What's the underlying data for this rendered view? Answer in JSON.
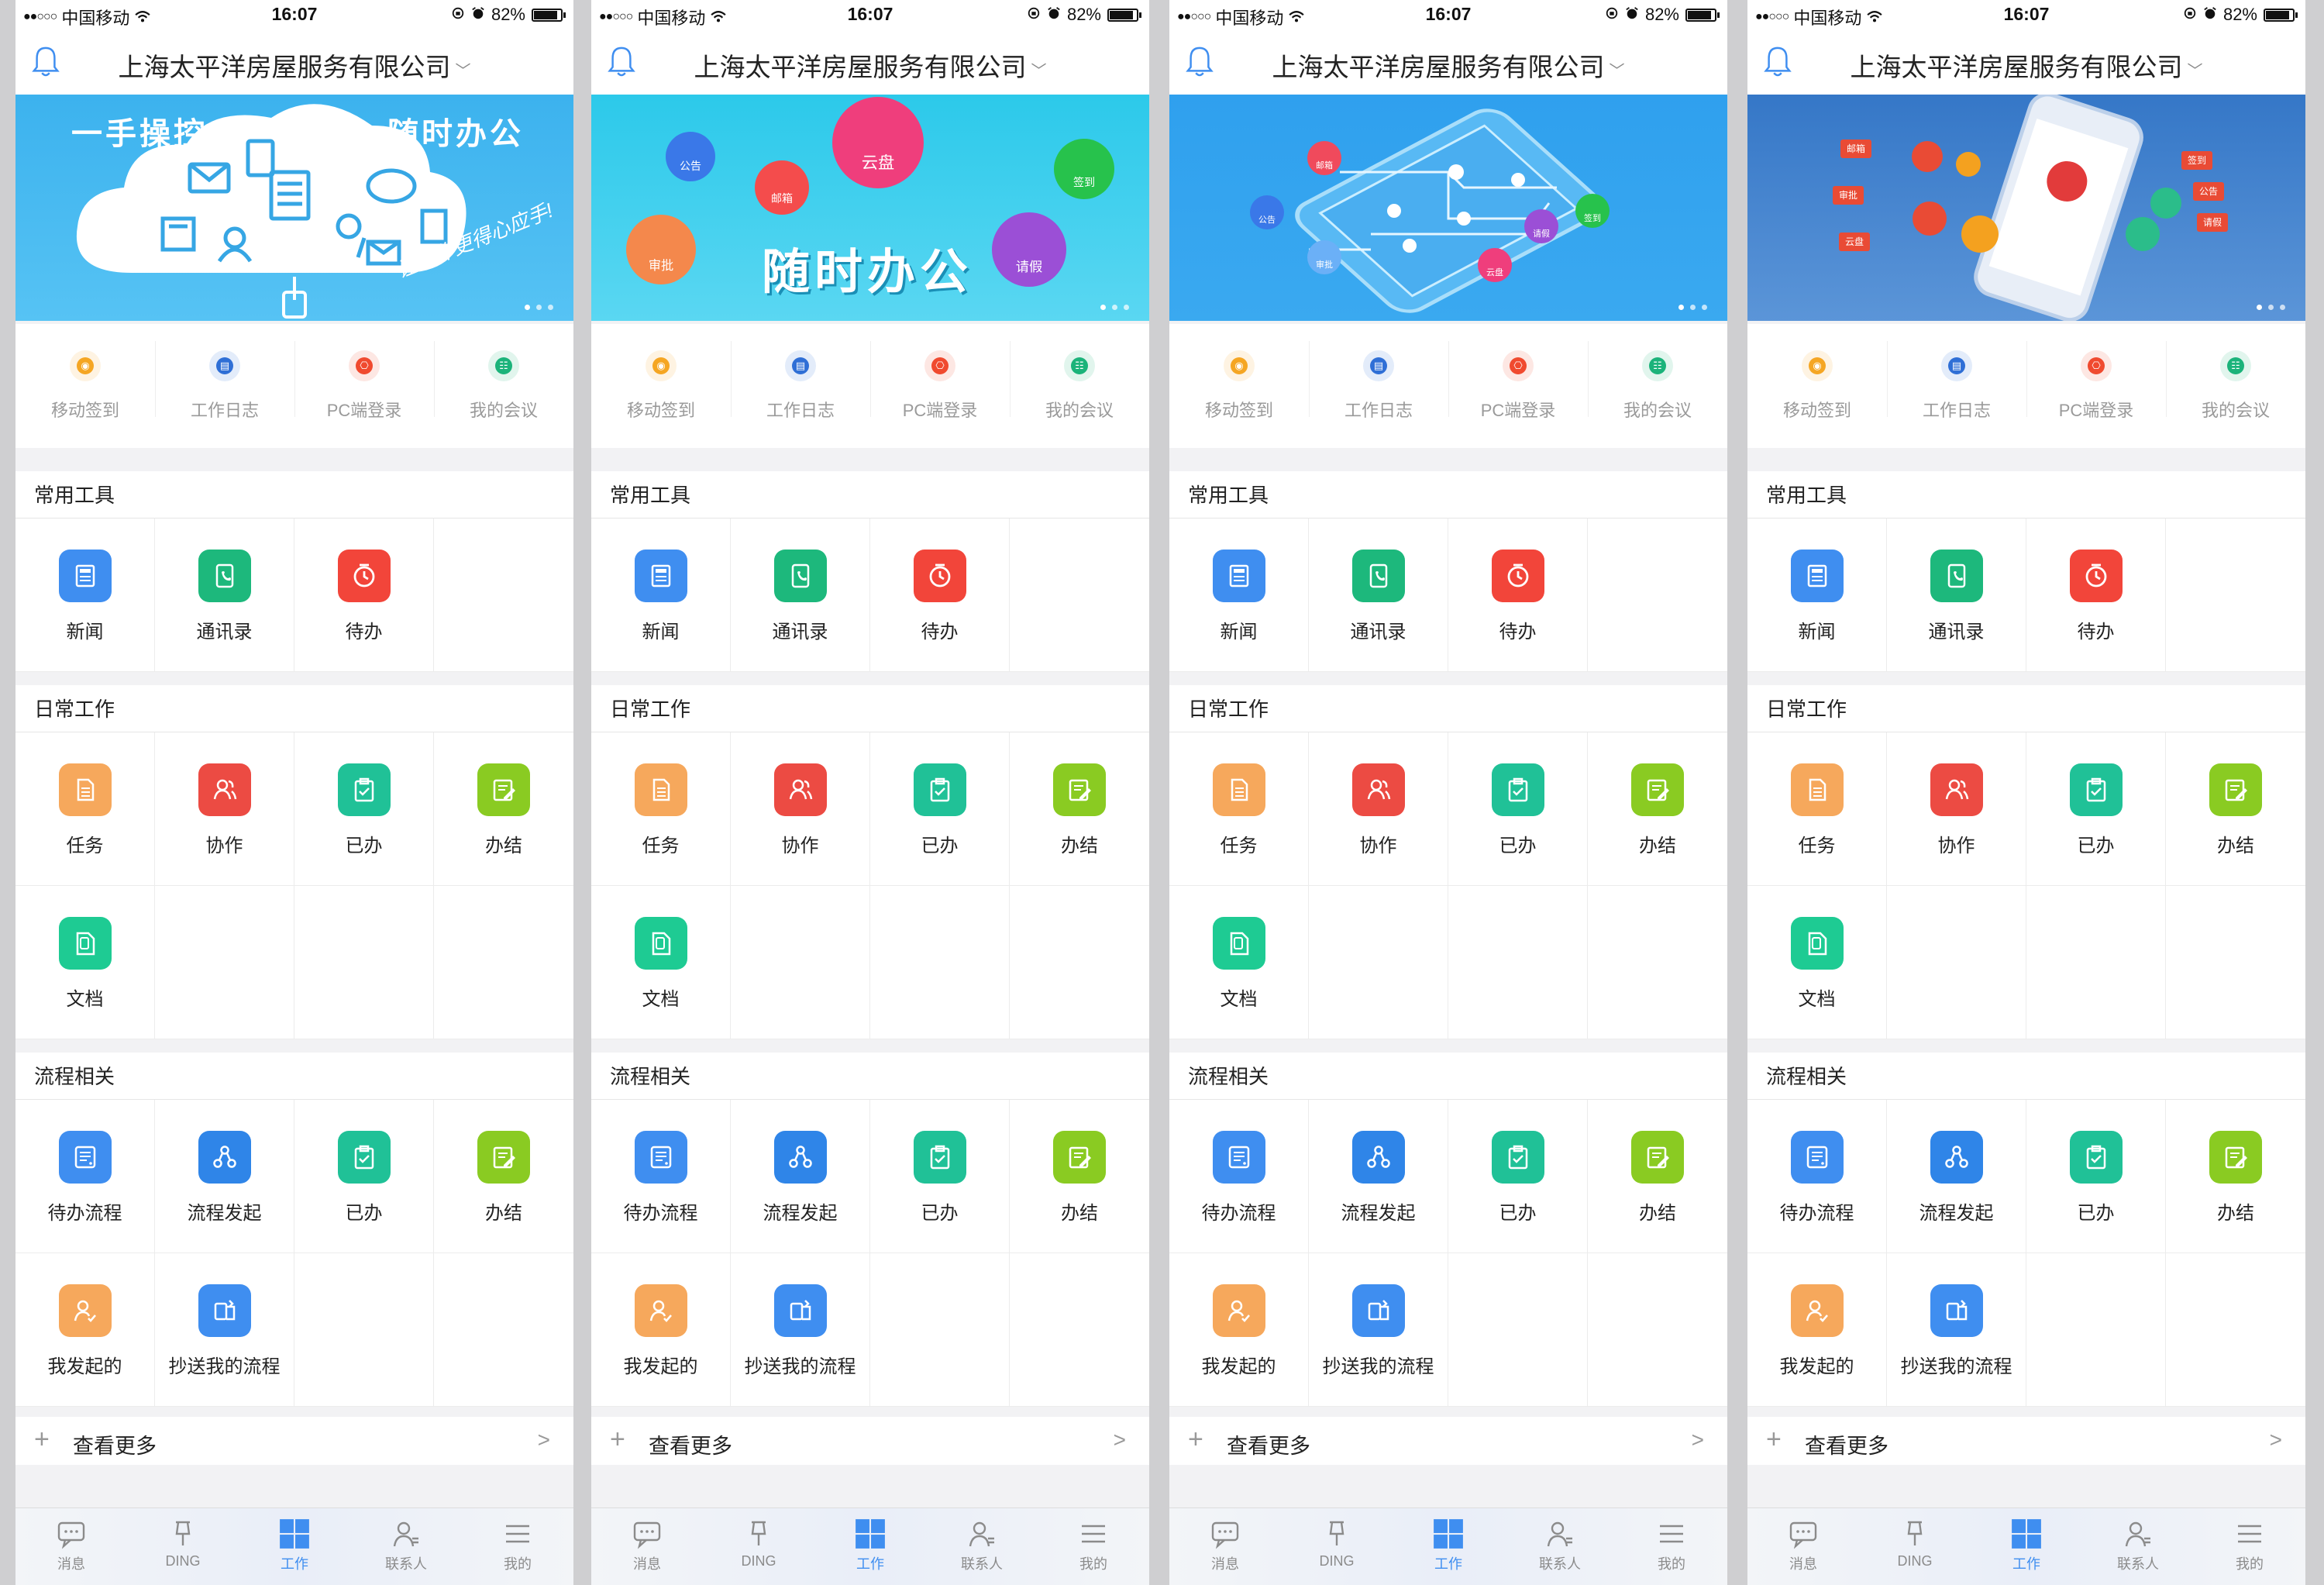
{
  "status_bar": {
    "carrier": "中国移动",
    "signal": "●●○○○",
    "time": "16:07",
    "battery": "82%"
  },
  "header": {
    "company": "上海太平洋房屋服务有限公司"
  },
  "banners": [
    {
      "line1": "一手操控",
      "line2": "随时办公",
      "slogan": "让工作更得心应手!"
    },
    {
      "title": "随时办公",
      "bubbles": [
        "云盘",
        "请假",
        "审批",
        "邮箱",
        "公告",
        "签到"
      ]
    },
    {
      "bubbles": [
        "邮箱",
        "公告",
        "审批",
        "请假",
        "签到",
        "云盘"
      ]
    },
    {
      "bubbles": [
        "邮箱",
        "审批",
        "云盘",
        "签到",
        "公告",
        "请假"
      ]
    }
  ],
  "quick_actions": [
    {
      "label": "移动签到",
      "color": "#f5a623"
    },
    {
      "label": "工作日志",
      "color": "#2f6fd6"
    },
    {
      "label": "PC端登录",
      "color": "#f04a2f"
    },
    {
      "label": "我的会议",
      "color": "#1bb37a"
    }
  ],
  "sections": [
    {
      "title": "常用工具",
      "items": [
        {
          "label": "新闻",
          "icon": "news-icon",
          "color": "#3f8ef0"
        },
        {
          "label": "通讯录",
          "icon": "contacts-icon",
          "color": "#1db87c"
        },
        {
          "label": "待办",
          "icon": "timer-icon",
          "color": "#f2453a"
        }
      ]
    },
    {
      "title": "日常工作",
      "items": [
        {
          "label": "任务",
          "icon": "task-icon",
          "color": "#f6a85c"
        },
        {
          "label": "协作",
          "icon": "collaborate-icon",
          "color": "#ec4b43"
        },
        {
          "label": "已办",
          "icon": "clipboard-check-icon",
          "color": "#20c197"
        },
        {
          "label": "办结",
          "icon": "edit-doc-icon",
          "color": "#8acb22"
        },
        {
          "label": "文档",
          "icon": "document-icon",
          "color": "#1ecb93"
        }
      ]
    },
    {
      "title": "流程相关",
      "items": [
        {
          "label": "待办流程",
          "icon": "process-list-icon",
          "color": "#3f8ef0"
        },
        {
          "label": "流程发起",
          "icon": "process-start-icon",
          "color": "#2f85e8"
        },
        {
          "label": "已办",
          "icon": "clipboard-check-icon",
          "color": "#20c197"
        },
        {
          "label": "办结",
          "icon": "edit-doc-icon",
          "color": "#8acb22"
        },
        {
          "label": "我发起的",
          "icon": "user-process-icon",
          "color": "#f6a85c"
        },
        {
          "label": "抄送我的流程",
          "icon": "cc-process-icon",
          "color": "#3f8ef0"
        }
      ]
    }
  ],
  "more": {
    "label": "查看更多",
    "arrow": ">"
  },
  "tabs": [
    {
      "label": "消息",
      "icon": "message-icon"
    },
    {
      "label": "DING",
      "icon": "pin-icon"
    },
    {
      "label": "工作",
      "icon": "grid-icon",
      "active": true
    },
    {
      "label": "联系人",
      "icon": "contacts-person-icon"
    },
    {
      "label": "我的",
      "icon": "menu-icon"
    }
  ]
}
